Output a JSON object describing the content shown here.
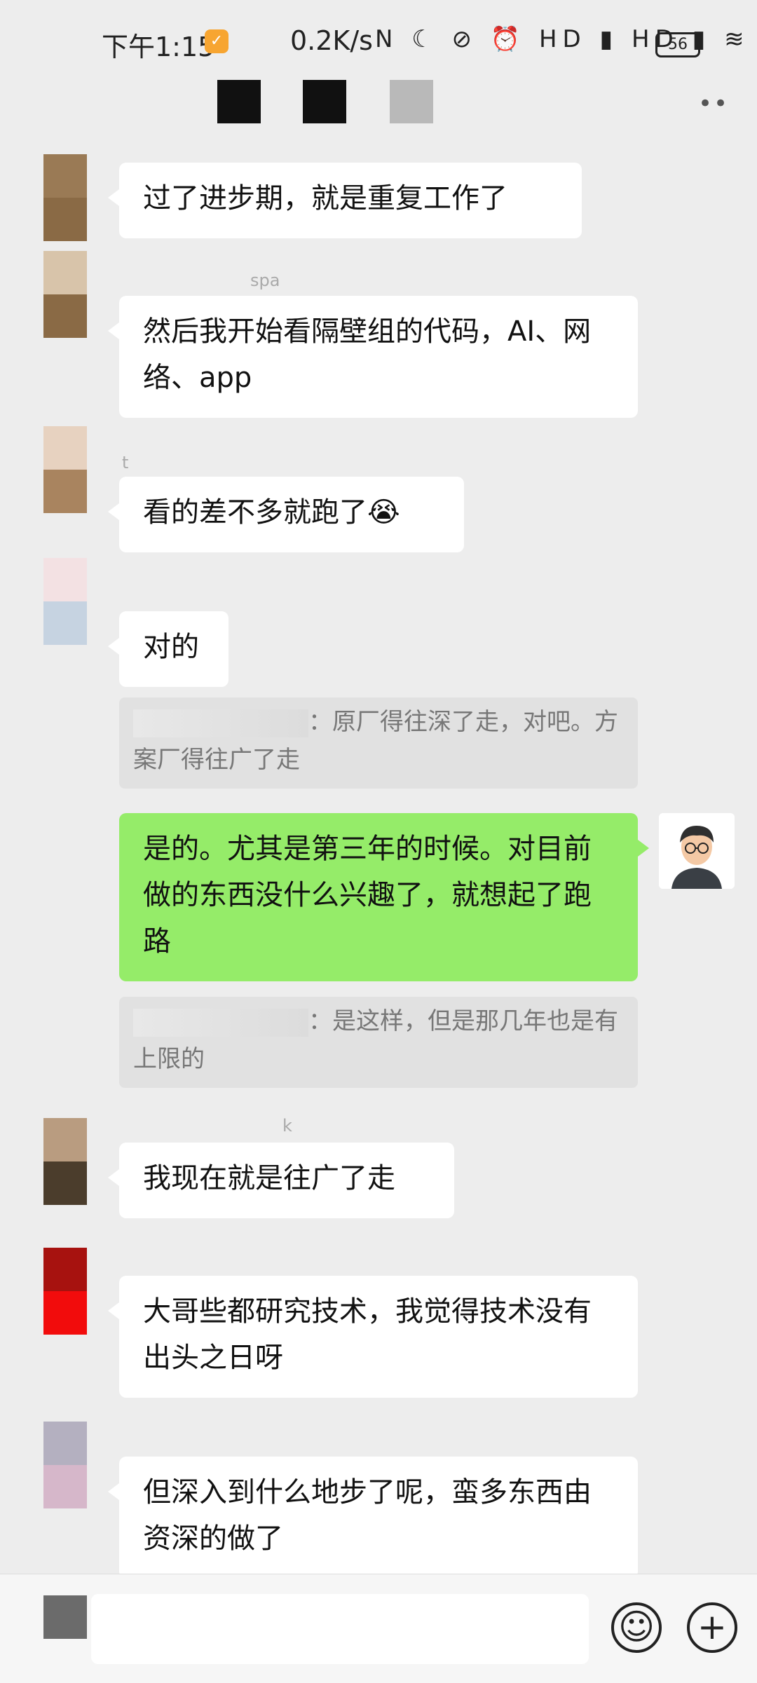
{
  "status_bar": {
    "time": "下午1:15",
    "badge": "✓",
    "network_speed": "0.2K/s",
    "icons": "N ☾ ⊘ ⏰ HD ▮ HD ▮ ≋",
    "battery": "56"
  },
  "header": {
    "more": "••"
  },
  "messages": [
    {
      "id": 1,
      "sender": "",
      "text": "过了进步期，就是重复工作了",
      "avatar_colors": [
        "#9a7a55",
        "#8a6a45"
      ]
    },
    {
      "id": 2,
      "sender": "spa",
      "text": "然后我开始看隔壁组的代码，AI、网络、app",
      "avatar_colors": [
        "#d8c4aa",
        "#8a6a45"
      ]
    },
    {
      "id": 3,
      "sender": "t",
      "text": "看的差不多就跑了😭",
      "avatar_colors": [
        "#e7d2c0",
        "#a9845f"
      ]
    },
    {
      "id": 4,
      "sender": "",
      "text": "对的",
      "avatar_colors": [
        "#f3e1e3",
        "#c6d3e1"
      ]
    },
    {
      "id": 5,
      "quote": true,
      "text": "：原厂得往深了走，对吧。方案厂得往广了走"
    },
    {
      "id": 6,
      "me": true,
      "text": "是的。尤其是第三年的时候。对目前做的东西没什么兴趣了，就想起了跑路"
    },
    {
      "id": 7,
      "quote": true,
      "text": "：是这样，但是那几年也是有上限的"
    },
    {
      "id": 8,
      "sender": "k",
      "text": "我现在就是往广了走",
      "avatar_colors": [
        "#b99c80",
        "#4b3d2c"
      ]
    },
    {
      "id": 9,
      "sender": "",
      "text": "大哥些都研究技术，我觉得技术没有出头之日呀",
      "avatar_colors": [
        "#a7120f",
        "#f20c0c"
      ]
    },
    {
      "id": 10,
      "sender": "",
      "text": "但深入到什么地步了呢，蛮多东西由资深的做了",
      "avatar_colors": [
        "#b4b0c0",
        "#d6b7ca"
      ]
    }
  ],
  "input": {
    "placeholder": "",
    "emoji_icon": "☺",
    "plus_icon": "+"
  }
}
